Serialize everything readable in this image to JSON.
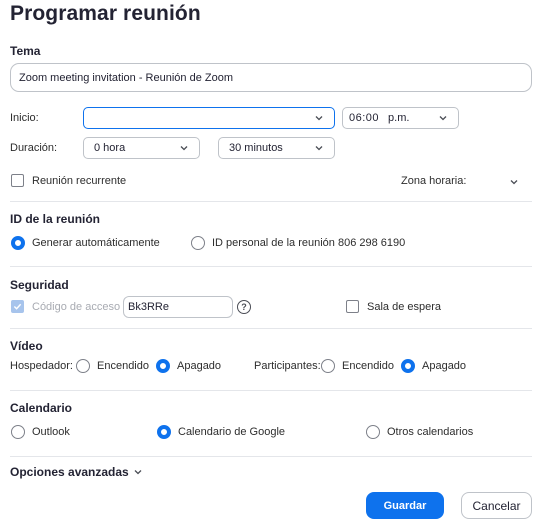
{
  "title": "Programar reunión",
  "topic": {
    "label": "Tema",
    "value": "Zoom meeting invitation - Reunión de Zoom"
  },
  "start": {
    "label": "Inicio:",
    "date_value": "",
    "time_value": "06:00",
    "ampm": "p.m."
  },
  "duration": {
    "label": "Duración:",
    "hours_value": "0 hora",
    "minutes_value": "30 minutos"
  },
  "recurring": {
    "label": "Reunión recurrente",
    "checked": false
  },
  "timezone": {
    "label": "Zona horaria:"
  },
  "meeting_id": {
    "section": "ID de la reunión",
    "auto_label": "Generar automáticamente",
    "personal_label": "ID personal de la reunión 806 298 6190",
    "selected": "auto"
  },
  "security": {
    "section": "Seguridad",
    "passcode_label": "Código de acceso",
    "passcode_value": "Bk3RRe",
    "help_glyph": "?",
    "waiting_room_label": "Sala de espera"
  },
  "video": {
    "section": "Vídeo",
    "host_label": "Hospedador:",
    "participants_label": "Participantes:",
    "on_label": "Encendido",
    "off_label": "Apagado",
    "host_selected": "off",
    "participants_selected": "off"
  },
  "calendar": {
    "section": "Calendario",
    "outlook": "Outlook",
    "google": "Calendario de Google",
    "other": "Otros calendarios",
    "selected": "google"
  },
  "advanced": {
    "label": "Opciones avanzadas"
  },
  "buttons": {
    "save": "Guardar",
    "cancel": "Cancelar"
  },
  "colors": {
    "accent": "#0e72ed",
    "text": "#232333",
    "border": "#bfc3c9"
  }
}
